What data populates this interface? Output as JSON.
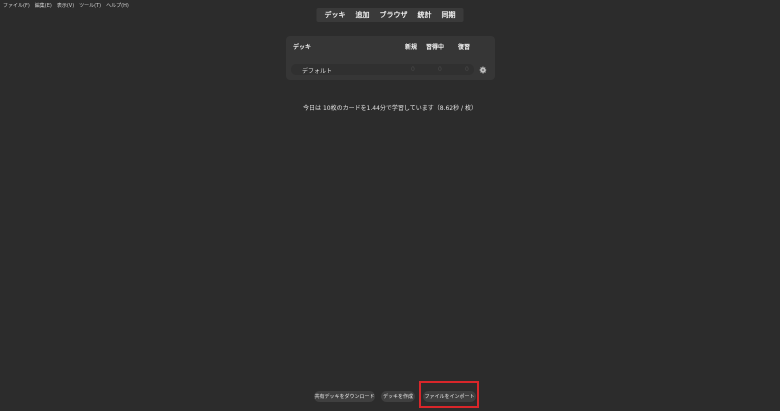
{
  "menubar": {
    "items": [
      "ファイル(F)",
      "編集(E)",
      "表示(V)",
      "ツール(T)",
      "ヘルプ(H)"
    ]
  },
  "topnav": {
    "items": [
      "デッキ",
      "追加",
      "ブラウザ",
      "統計",
      "同期"
    ]
  },
  "deck_table": {
    "headers": {
      "deck": "デッキ",
      "new": "新規",
      "learning": "習得中",
      "review": "復習"
    },
    "rows": [
      {
        "name": "デフォルト",
        "new": "0",
        "learning": "0",
        "review": "0"
      }
    ]
  },
  "stats_text": "今日は 10枚のカードを1.44分で学習しています（8.62秒 / 枚）",
  "buttons": {
    "shared": "共有デッキをダウンロード",
    "create": "デッキを作成",
    "import": "ファイルをインポート"
  },
  "colors": {
    "background": "#2c2c2c",
    "panel": "#363636",
    "highlight": "#d8262a"
  },
  "icons": {
    "deck_options": "gear-icon"
  }
}
